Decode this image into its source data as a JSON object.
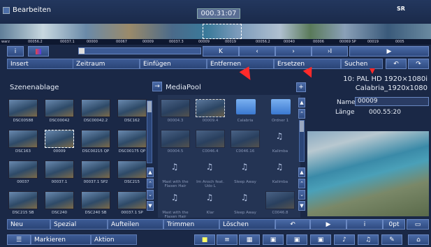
{
  "window": {
    "title": "Bearbeiten",
    "logo": "SR"
  },
  "timecode": "000.31:07",
  "timeline": {
    "labels": [
      "warz",
      "00056.2",
      "00037.1",
      "00000",
      "00067",
      "00009",
      "00037.3",
      "00009",
      "00019",
      "00056.2",
      "00040",
      "00006",
      "00069 SP",
      "00019",
      "0005"
    ]
  },
  "transport_row": {
    "info": "i"
  },
  "actions": {
    "insert": "Insert",
    "zeitraum": "Zeitraum",
    "einfuegen": "Einfügen",
    "entfernen": "Entfernen",
    "ersetzen": "Ersetzen",
    "suchen": "Suchen"
  },
  "panels": {
    "szenenablage": "Szenenablage",
    "mediapool": "MediaPool"
  },
  "project": {
    "format": "10: PAL HD 1920×1080i",
    "name": "Calabria_1920x1080"
  },
  "details": {
    "name_label": "Name",
    "name_value": "00009",
    "length_label": "Länge",
    "length_value": "000.55:20"
  },
  "scenes": [
    [
      "DSC00588",
      "DSC00042",
      "DSC00042.2",
      "DSC162"
    ],
    [
      "DSC163",
      "00009",
      "DSC00215 QP",
      "DSC00175 QP"
    ],
    [
      "00037",
      "00037.1",
      "00037.1 SP2",
      "DSC215"
    ],
    [
      "DSC215 SB",
      "DSC240",
      "DSC240 SB",
      "00037.1 SP"
    ]
  ],
  "media": [
    [
      "00004.3",
      "00009.4",
      "Calabria",
      "Ordner 1"
    ],
    [
      "00004.5",
      "C0046.4",
      "C0046.16",
      "Kalimba"
    ],
    [
      "Mast with the Flaxen Hair",
      "Im Ansch feat. Udo L",
      "Sleep Away",
      "Kalimba"
    ],
    [
      "Mast with the Flaxen Hair",
      "Klar",
      "Sleep Away",
      "C0046.8"
    ]
  ],
  "bottom_row": {
    "neu": "Neu",
    "spezial": "Spezial",
    "aufteilen": "Aufteilen",
    "trimmen": "Trimmen",
    "loeschen": "Löschen",
    "info": "i",
    "opt": "0pt"
  },
  "status_row": {
    "markieren": "Markieren",
    "aktion": "Aktion"
  },
  "colors": {
    "background": "#1a2846",
    "accent": "#3c5a94",
    "red_arrow": "#ff2a2a"
  }
}
